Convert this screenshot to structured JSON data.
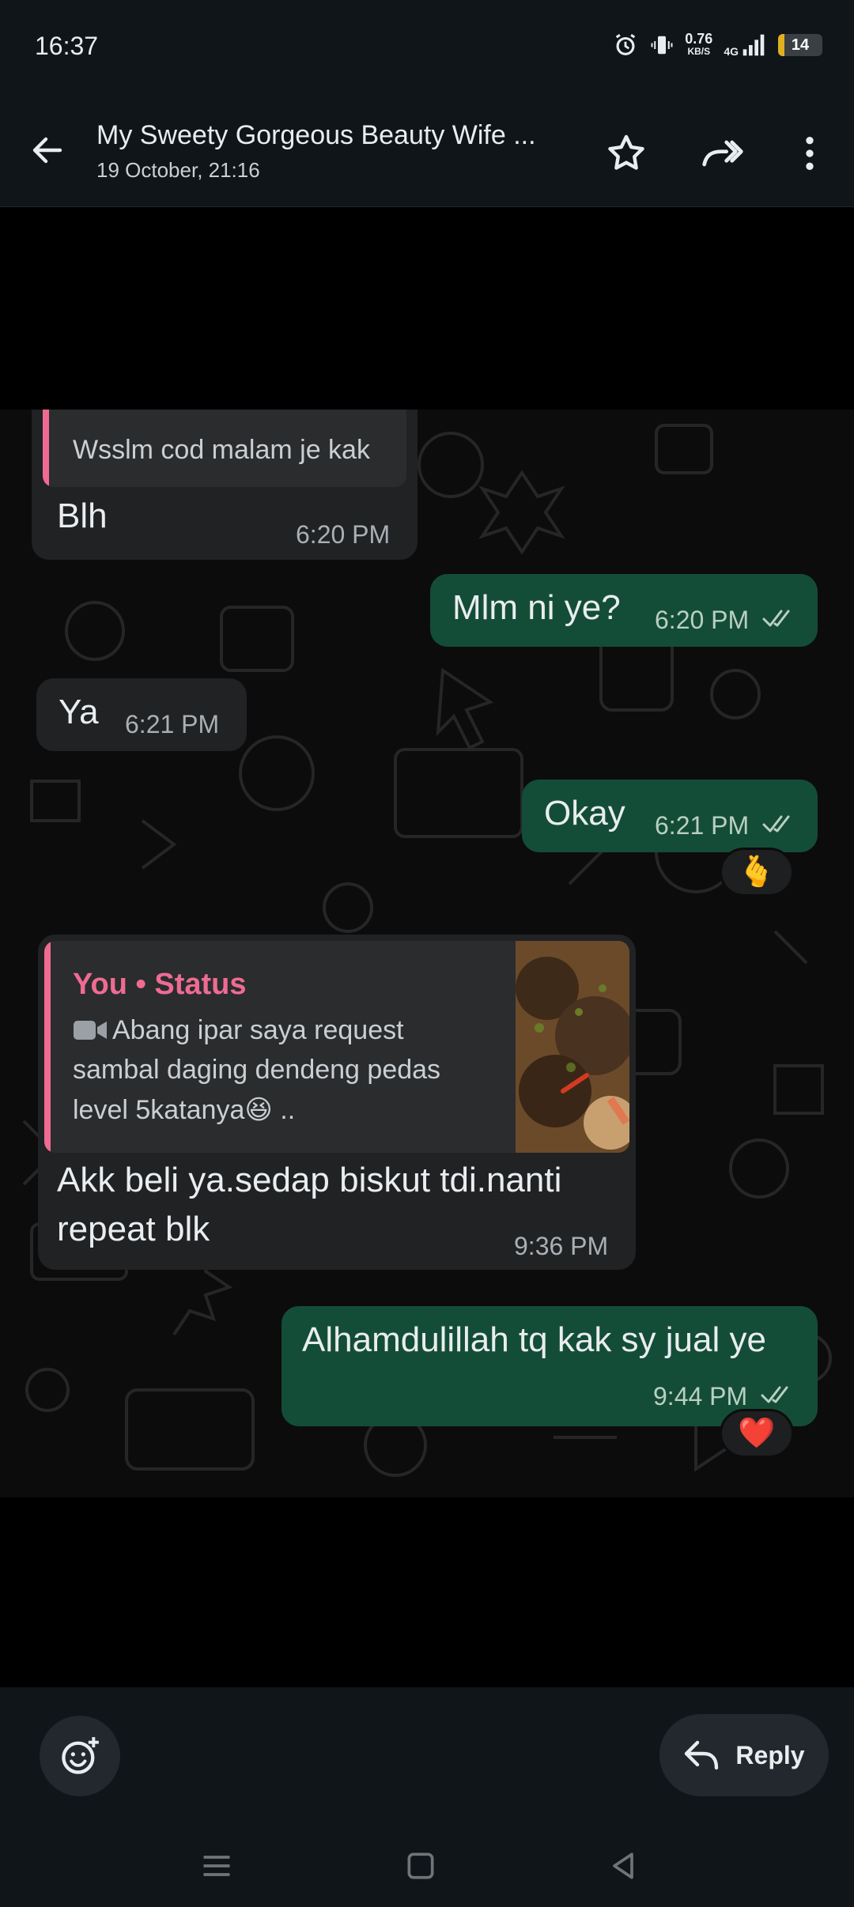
{
  "status_bar": {
    "time": "16:37",
    "net_speed_value": "0.76",
    "net_speed_unit": "KB/S",
    "network_type": "4G",
    "battery_level": "14"
  },
  "app_bar": {
    "title": "My Sweety Gorgeous Beauty Wife ...",
    "subtitle": "19 October, 21:16",
    "icons": [
      "back-arrow-icon",
      "star-icon",
      "forward-icon",
      "more-vert-icon"
    ]
  },
  "messages": [
    {
      "direction": "in",
      "quoted_text": "Wsslm cod malam je kak",
      "text": "Blh",
      "time": "6:20 PM"
    },
    {
      "direction": "out",
      "text": "Mlm ni ye?",
      "time": "6:20 PM",
      "read": true
    },
    {
      "direction": "in",
      "text": "Ya",
      "time": "6:21 PM"
    },
    {
      "direction": "out",
      "text": "Okay",
      "time": "6:21 PM",
      "read": true,
      "reaction": "🫰"
    },
    {
      "direction": "in",
      "quote": {
        "header": "You • Status",
        "line1": "Abang ipar saya request",
        "line2": "sambal daging dendeng pedas",
        "line3": "level 5katanya",
        "emoji": "😆",
        "suffix": " .."
      },
      "line1": "Akk beli ya.sedap biskut tdi.nanti",
      "line2": "repeat blk",
      "time": "9:36 PM"
    },
    {
      "direction": "out",
      "text": "Alhamdulillah tq kak sy jual ye",
      "time": "9:44 PM",
      "read": true,
      "reaction": "❤️"
    }
  ],
  "bottom_bar": {
    "reply_label": "Reply"
  },
  "colors": {
    "incoming_bubble": "#202224",
    "outgoing_bubble": "#144d37",
    "quote_accent": "#ef6b92",
    "read_ticks": "#b9cfc4"
  }
}
